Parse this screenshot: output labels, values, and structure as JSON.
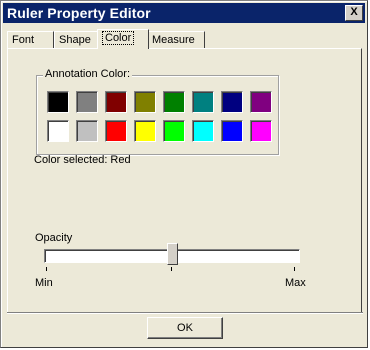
{
  "window": {
    "title": "Ruler Property Editor",
    "close_label": "X"
  },
  "tabs": [
    {
      "label": "Font",
      "active": false
    },
    {
      "label": "Shape",
      "active": false
    },
    {
      "label": "Color",
      "active": true
    },
    {
      "label": "Measure",
      "active": false
    }
  ],
  "annotation": {
    "group_label": "Annotation Color:",
    "swatches_row1": [
      "#000000",
      "#808080",
      "#800000",
      "#808000",
      "#008000",
      "#008080",
      "#000080",
      "#800080"
    ],
    "swatches_row2": [
      "#ffffff",
      "#c0c0c0",
      "#ff0000",
      "#ffff00",
      "#00ff00",
      "#00ffff",
      "#0000ff",
      "#ff00ff"
    ],
    "selected_text": "Color selected: Red"
  },
  "opacity": {
    "label": "Opacity",
    "min_label": "Min",
    "max_label": "Max",
    "value_fraction": 0.5
  },
  "buttons": {
    "ok_label": "OK"
  }
}
